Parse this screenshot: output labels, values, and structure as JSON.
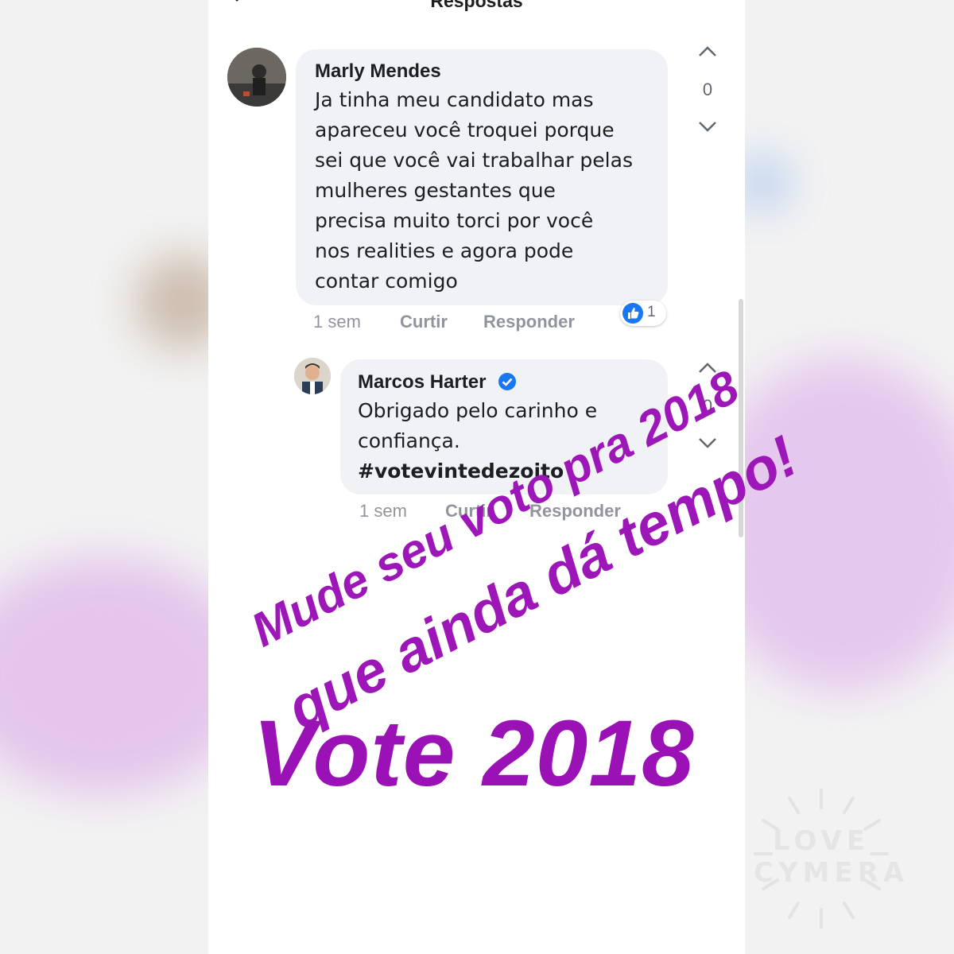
{
  "header": {
    "title": "Respostas"
  },
  "comments": [
    {
      "author": "Marly Mendes",
      "text": "Ja tinha meu candidato mas\napareceu você troquei porque\nsei que você vai trabalhar pelas\nmulheres gestantes que\nprecisa muito torci por você\nnos realities e agora pode\ncontar comigo",
      "time": "1 sem",
      "like_label": "Curtir",
      "reply_label": "Responder",
      "reactions": "1",
      "vote_count": "0"
    },
    {
      "author": "Marcos Harter",
      "verified": true,
      "text": "Obrigado pelo carinho e\nconfiança.",
      "hashtag": "#votevintedezoito",
      "time": "1 sem",
      "like_label": "Curtir",
      "reply_label": "Responder",
      "vote_count": "0"
    }
  ],
  "overlay": {
    "line1": "Mude seu voto pra 2018",
    "line2": "que ainda dá tempo!",
    "big": "Vote 2018"
  },
  "watermark": {
    "line1": "LOVE",
    "line2": "CYMERA"
  },
  "colors": {
    "overlay_purple": "#9d16b8",
    "like_blue": "#1877f2"
  }
}
